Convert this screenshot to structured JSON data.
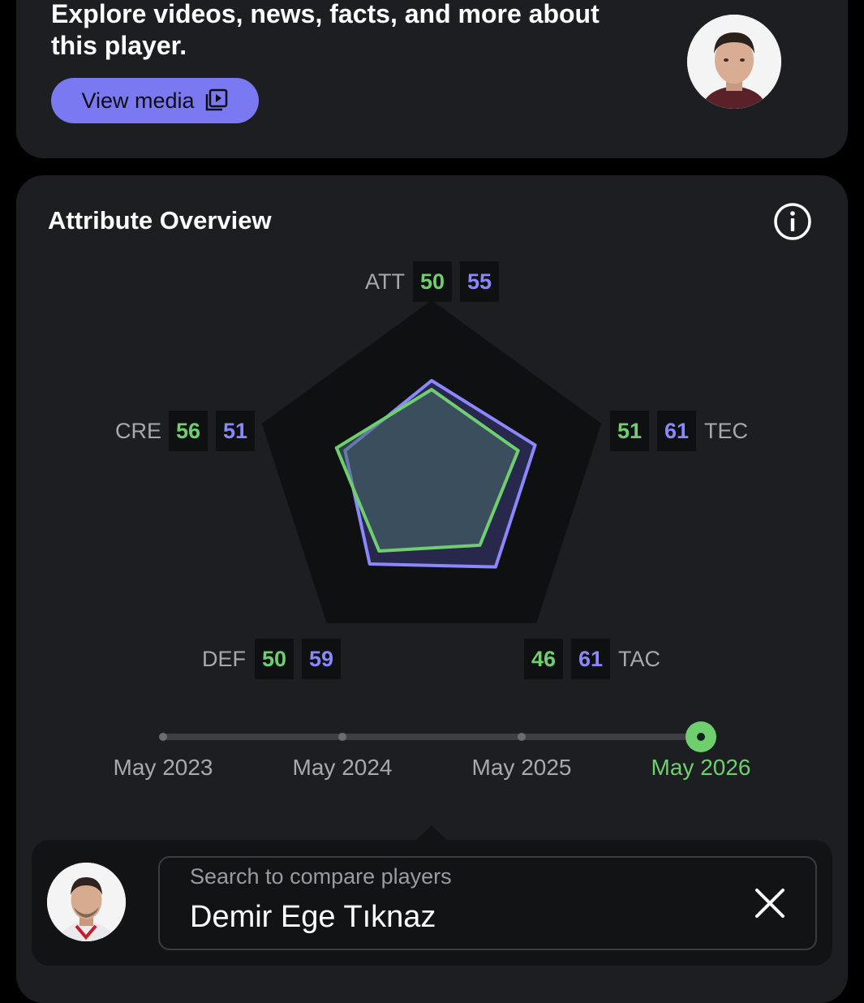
{
  "promo": {
    "text": "Explore videos, news, facts, and more about this player.",
    "button_label": "View media"
  },
  "attributes": {
    "title": "Attribute Overview",
    "items": {
      "att": {
        "label": "ATT",
        "player": "50",
        "compare": "55"
      },
      "tec": {
        "label": "TEC",
        "player": "51",
        "compare": "61"
      },
      "tac": {
        "label": "TAC",
        "player": "46",
        "compare": "61"
      },
      "def": {
        "label": "DEF",
        "player": "50",
        "compare": "59"
      },
      "cre": {
        "label": "CRE",
        "player": "56",
        "compare": "51"
      }
    }
  },
  "chart_data": {
    "type": "radar",
    "axes": [
      "ATT",
      "TEC",
      "TAC",
      "DEF",
      "CRE"
    ],
    "series": [
      {
        "values": [
          50,
          51,
          46,
          50,
          56
        ],
        "color": "#6fcf6f"
      },
      {
        "values": [
          55,
          61,
          61,
          59,
          51
        ],
        "color": "#8a87ff"
      }
    ],
    "range": [
      0,
      100
    ]
  },
  "timeline": {
    "points": [
      "May 2023",
      "May 2024",
      "May 2025",
      "May 2026"
    ],
    "selected": "May 2026"
  },
  "compare": {
    "placeholder": "Search to compare players",
    "value": "Demir Ege Tıknaz"
  },
  "colors": {
    "green": "#6fcf6f",
    "purple": "#8a87ff",
    "accent_button": "#7b79f2",
    "card": "#1c1e21"
  }
}
